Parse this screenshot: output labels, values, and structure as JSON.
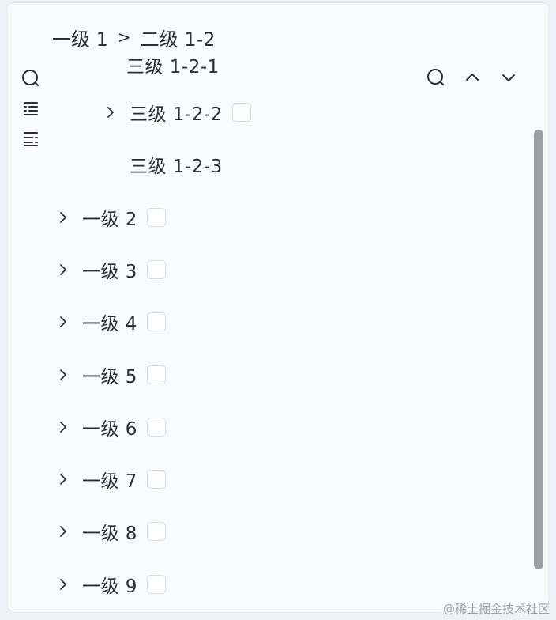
{
  "breadcrumb": {
    "items": [
      "一级 1",
      "二级 1-2"
    ],
    "separator": ">"
  },
  "toolbar": {
    "left_icons": [
      "search-icon",
      "expand-all-icon",
      "collapse-all-icon"
    ],
    "right_icons": [
      "search-icon",
      "chevron-up-icon",
      "chevron-down-icon"
    ]
  },
  "tree": {
    "partial_node_label": "三级 1-2-1",
    "nodes": [
      {
        "label": "三级 1-2-2",
        "level": 3,
        "has_children": true,
        "checked": false
      },
      {
        "label": "三级 1-2-3",
        "level": 3,
        "has_children": false,
        "checked": null
      },
      {
        "label": "一级 2",
        "level": 1,
        "has_children": true,
        "checked": false
      },
      {
        "label": "一级 3",
        "level": 1,
        "has_children": true,
        "checked": false
      },
      {
        "label": "一级 4",
        "level": 1,
        "has_children": true,
        "checked": false
      },
      {
        "label": "一级 5",
        "level": 1,
        "has_children": true,
        "checked": false
      },
      {
        "label": "一级 6",
        "level": 1,
        "has_children": true,
        "checked": false
      },
      {
        "label": "一级 7",
        "level": 1,
        "has_children": true,
        "checked": false
      },
      {
        "label": "一级 8",
        "level": 1,
        "has_children": true,
        "checked": false
      },
      {
        "label": "一级 9",
        "level": 1,
        "has_children": true,
        "checked": false
      }
    ]
  },
  "watermark": "@稀土掘金技术社区",
  "colors": {
    "text": "#2b2e36",
    "panel": "#fafbfe",
    "scrollbar": "#9e9fa3",
    "checkbox_border": "#d9dce3"
  }
}
